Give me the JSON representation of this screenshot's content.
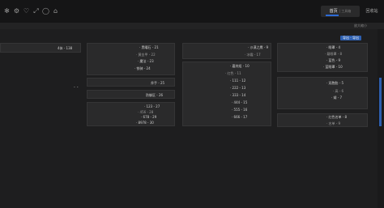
{
  "toolbar": {
    "icons": [
      "sun-icon",
      "settings-icon",
      "heart-icon",
      "expand-icon",
      "chat-icon",
      "tag-icon"
    ]
  },
  "tabs": {
    "active_label": "首页",
    "active_sub": "| 工具箱",
    "second_label": "回收站"
  },
  "subbar": {
    "caption": "放大缩小"
  },
  "blue_button": "导出 - 导出",
  "cards": {
    "c1": {
      "lines": [
        "4体 - 138"
      ]
    },
    "c2": {
      "lines": [
        "· 黑曜石 - 21",
        "· 黄金甲 - 22",
        "· 魔法 - 23",
        "· 铁骑 - 24"
      ]
    },
    "c3": {
      "lines": [
        "· 沙漠之鹰 - 9",
        "· 冰霜 - 17"
      ]
    },
    "c4": {
      "lines": [
        "· 眼罩 - 4",
        "· 戴眼罩 - 8",
        "· 蓝色 - 9",
        "· 蓝眼罩 - 10"
      ]
    },
    "c5": {
      "lines": [
        "· 嘉宾组 - 10",
        "· 红色 - 11",
        "· 111 - 12",
        "· 222 - 13",
        "· 333 - 14",
        "· 444 - 15",
        "· 555 - 16",
        "· 666 - 17"
      ]
    },
    "c6": {
      "lines": [
        "· 双胞胎 - 5",
        "· 高 - 6",
        "· 矮 - 7"
      ]
    },
    "c7": {
      "lines": [
        "斧手 - 25"
      ]
    },
    "c8": {
      "lines": [
        "防御区 - 26"
      ]
    },
    "c9": {
      "lines": [
        "· 123 - 27",
        "· 456 - 28",
        "· 678 - 29",
        "· 8978 - 30"
      ]
    },
    "c10": {
      "lines": [
        "· 红色名单 - 8",
        "· 名单 - 9"
      ]
    }
  }
}
